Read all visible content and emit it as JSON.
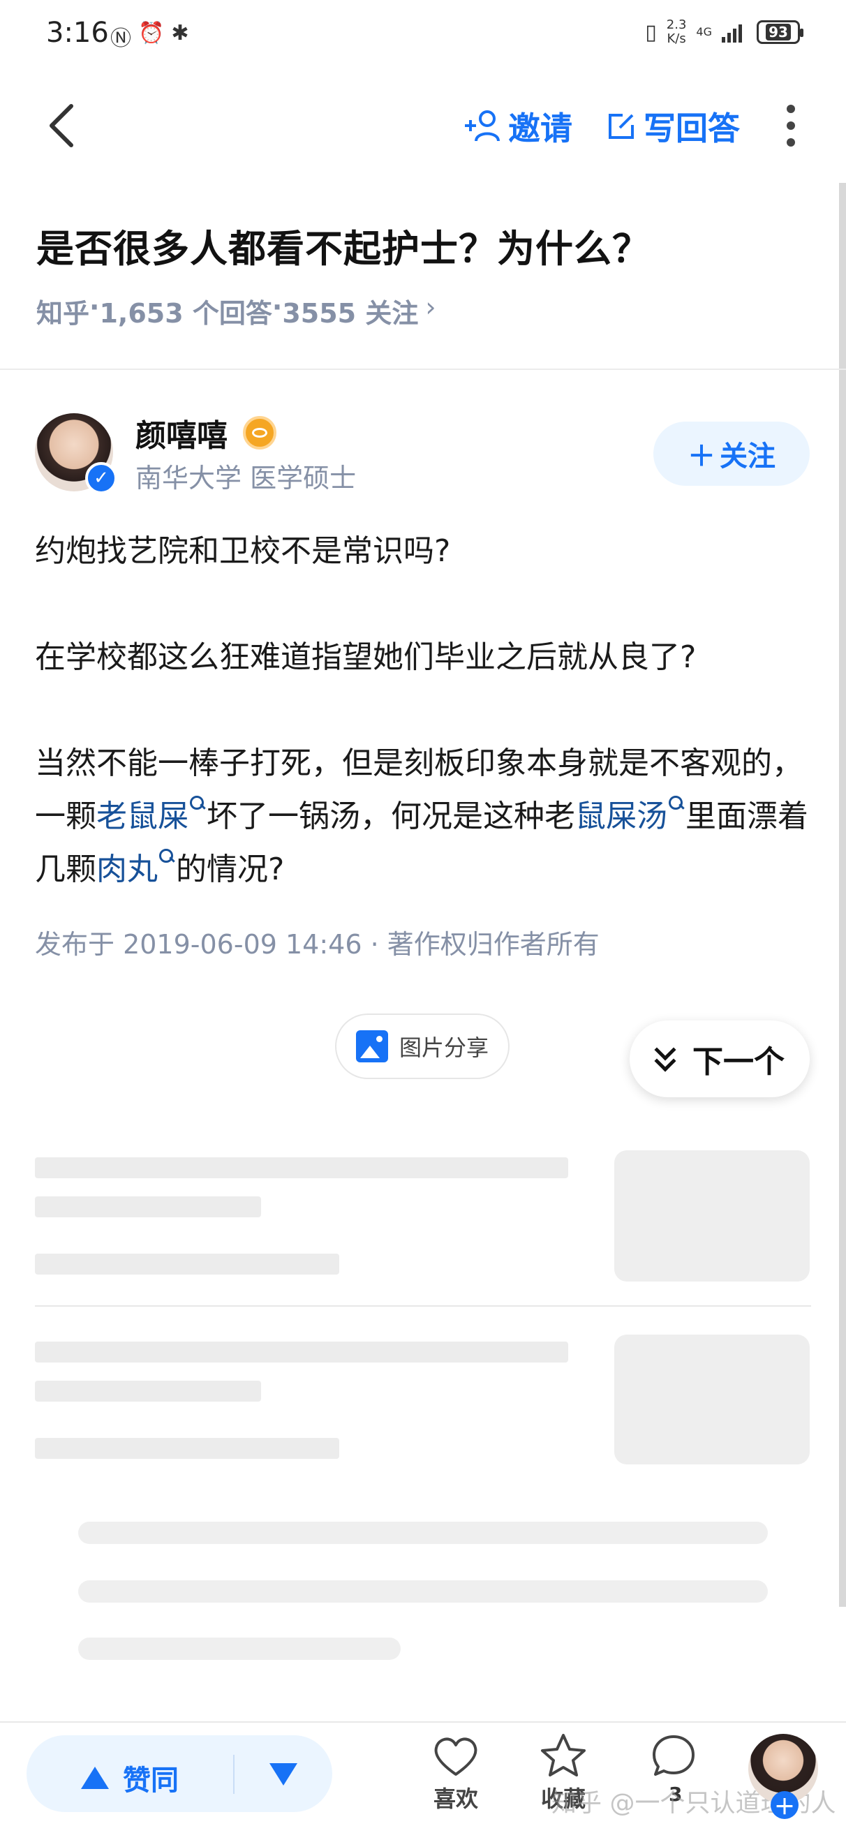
{
  "status_bar": {
    "time": "3:16",
    "left_icons": [
      "nfc-icon",
      "alarm-icon",
      "bluetooth-icon"
    ],
    "net_speed_value": "2.3",
    "net_speed_unit": "K/s",
    "signal_label": "4G",
    "battery": "93"
  },
  "nav": {
    "invite_label": "邀请",
    "write_answer_label": "写回答"
  },
  "question": {
    "title": "是否很多人都看不起护士？为什么？",
    "source": "知乎",
    "answers": "1,653 个回答",
    "followers": "3555 关注",
    "sep": " · ",
    "chevron": "›"
  },
  "author": {
    "name": "颜嘻嘻",
    "description": "南华大学 医学硕士",
    "follow_label": "关注",
    "follow_plus": "＋",
    "verified_mark": "✓"
  },
  "answer": {
    "p1": "约炮找艺院和卫校不是常识吗?",
    "p2": "在学校都这么狂难道指望她们毕业之后就从良了?",
    "p3_a": "当然不能一棒子打死，但是刻板印象本身就是不客观的，一颗",
    "kw1": "老鼠屎",
    "p3_b": "坏了一锅汤，何况是这种老",
    "kw2": "鼠屎汤",
    "p3_c": "里面漂着几颗",
    "kw3": "肉丸",
    "p3_d": "的情况?",
    "publish_info": "发布于 2019-06-09 14:46 · 著作权归作者所有"
  },
  "actions": {
    "image_share_label": "图片分享",
    "next_label": "下一个"
  },
  "bottom_bar": {
    "upvote_label": "赞同",
    "like_label": "喜欢",
    "favorite_label": "收藏",
    "comment_count": "3",
    "watermark": "知乎 @一个只认道理的人"
  },
  "colors": {
    "accent": "#1772f6",
    "keyword": "#175199",
    "meta": "#8590a6",
    "vote_bg": "#ebf5ff"
  }
}
